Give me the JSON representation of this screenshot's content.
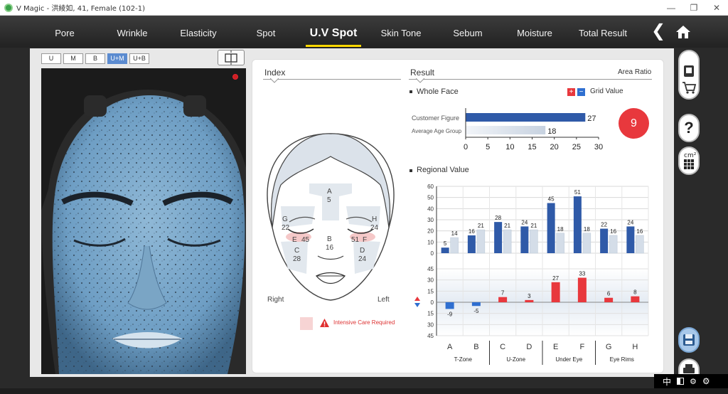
{
  "window": {
    "title": "V Magic - 洪綾如, 41, Female (102-1)"
  },
  "nav": {
    "tabs": [
      {
        "label": "Pore"
      },
      {
        "label": "Wrinkle"
      },
      {
        "label": "Elasticity"
      },
      {
        "label": "Spot"
      },
      {
        "label": "U.V Spot",
        "active": true
      },
      {
        "label": "Skin Tone"
      },
      {
        "label": "Sebum"
      },
      {
        "label": "Moisture"
      },
      {
        "label": "Total Result"
      }
    ]
  },
  "modes": [
    "U",
    "M",
    "B",
    "U+M",
    "U+B"
  ],
  "active_mode": "U+M",
  "index": {
    "title": "Index",
    "regions": [
      {
        "letter": "A",
        "value": "5"
      },
      {
        "letter": "B",
        "value": "16"
      },
      {
        "letter": "C",
        "value": "28"
      },
      {
        "letter": "D",
        "value": "24"
      },
      {
        "letter": "E",
        "value": "45"
      },
      {
        "letter": "F",
        "value": "51"
      },
      {
        "letter": "G",
        "value": "22"
      },
      {
        "letter": "H",
        "value": "24"
      }
    ],
    "right_label": "Right",
    "left_label": "Left",
    "legend": "Intensive Care Required"
  },
  "result": {
    "title": "Result",
    "area_ratio": "Area Ratio",
    "whole_face": "Whole Face",
    "grid_value": "Grid Value",
    "score": "9",
    "regional": "Regional Value",
    "accent_blue": "#2f5aa8",
    "accent_red": "#e8383d"
  },
  "chart_data": [
    {
      "type": "bar",
      "orientation": "horizontal",
      "categories": [
        "Customer Figure",
        "Average Age Group"
      ],
      "values": [
        27,
        18
      ],
      "xlim": [
        0,
        30
      ],
      "xticks": [
        "0",
        "5",
        "10",
        "15",
        "20",
        "25",
        "30"
      ]
    },
    {
      "type": "bar",
      "categories": [
        "A",
        "B",
        "C",
        "D",
        "E",
        "F",
        "G",
        "H"
      ],
      "groups": [
        "T-Zone",
        "U-Zone",
        "Under Eye",
        "Eye Rims"
      ],
      "series": [
        {
          "values": [
            5,
            16,
            28,
            24,
            45,
            51,
            22,
            24
          ]
        },
        {
          "values": [
            14,
            21,
            21,
            21,
            18,
            18,
            16,
            16
          ]
        }
      ],
      "ylim": [
        0,
        60
      ],
      "yticks": [
        "0",
        "10",
        "20",
        "30",
        "40",
        "50",
        "60"
      ]
    },
    {
      "type": "bar",
      "categories": [
        "A",
        "B",
        "C",
        "D",
        "E",
        "F",
        "G",
        "H"
      ],
      "values": [
        -9,
        -5,
        7,
        3,
        27,
        33,
        6,
        8
      ],
      "ylim": [
        -45,
        45
      ],
      "yticks": [
        "45",
        "30",
        "15",
        "0",
        "15",
        "30",
        "45"
      ]
    }
  ],
  "taskbar": {
    "ime": "中"
  }
}
